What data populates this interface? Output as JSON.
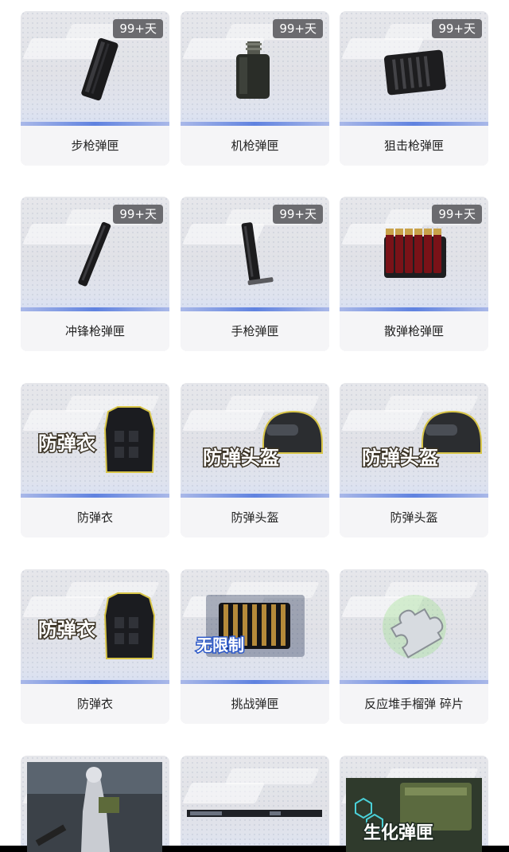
{
  "items": [
    {
      "name": "步枪弹匣",
      "badge": "99+天",
      "icon": "rifle-magazine-icon"
    },
    {
      "name": "机枪弹匣",
      "badge": "99+天",
      "icon": "machine-gun-magazine-icon"
    },
    {
      "name": "狙击枪弹匣",
      "badge": "99+天",
      "icon": "sniper-magazine-icon"
    },
    {
      "name": "冲锋枪弹匣",
      "badge": "99+天",
      "icon": "smg-magazine-icon"
    },
    {
      "name": "手枪弹匣",
      "badge": "99+天",
      "icon": "pistol-magazine-icon"
    },
    {
      "name": "散弹枪弹匣",
      "badge": "99+天",
      "icon": "shotgun-shells-icon"
    },
    {
      "name": "防弹衣",
      "badge": "",
      "icon": "body-armor-icon",
      "overlay": "防弹衣"
    },
    {
      "name": "防弹头盔",
      "badge": "",
      "icon": "helmet-icon",
      "overlay": "防弹头盔"
    },
    {
      "name": "防弹头盔",
      "badge": "",
      "icon": "helmet-icon",
      "overlay": "防弹头盔"
    },
    {
      "name": "防弹衣",
      "badge": "",
      "icon": "body-armor-icon",
      "overlay": "防弹衣"
    },
    {
      "name": "挑战弹匣",
      "badge": "",
      "icon": "challenge-ammo-icon",
      "overlay": "无限制"
    },
    {
      "name": "反应堆手榴弹 碎片",
      "badge": "",
      "icon": "puzzle-piece-icon"
    },
    {
      "name": "",
      "badge": "",
      "icon": "character-image-icon"
    },
    {
      "name": "",
      "badge": "",
      "icon": "banner-image-icon"
    },
    {
      "name": "",
      "badge": "",
      "icon": "bio-ammo-icon",
      "overlay": "生化弹匣"
    }
  ],
  "colors": {
    "badge_bg": "#6b6b6f",
    "accent_bar": "#5f82e0",
    "card_bg": "#f5f5f7"
  }
}
